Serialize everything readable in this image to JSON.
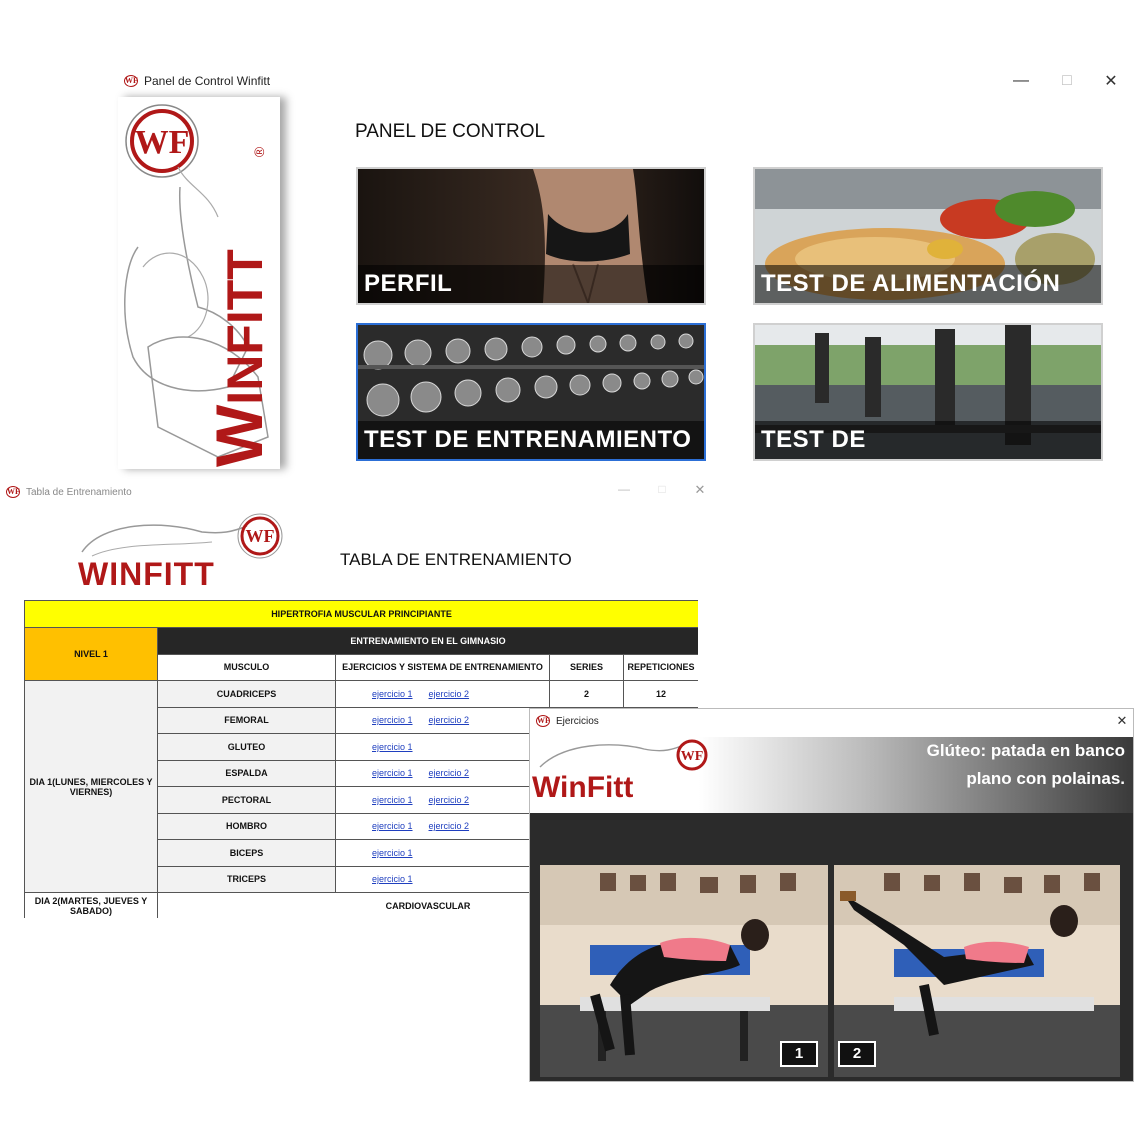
{
  "main_window": {
    "title": "Panel de Control Winfitt",
    "heading": "PANEL DE CONTROL",
    "tiles": [
      {
        "label": "PERFIL"
      },
      {
        "label": "TEST DE ALIMENTACIÓN"
      },
      {
        "label": "TEST DE ENTRENAMIENTO"
      },
      {
        "label": "TEST DE CARDIOVASCULAR"
      }
    ],
    "logo": {
      "letters": "WF",
      "word": "WINFITT"
    }
  },
  "training_window": {
    "title": "Tabla de Entrenamiento",
    "heading": "TABLA DE ENTRENAMIENTO",
    "logo_word": "WINFITT",
    "table": {
      "banner": "HIPERTROFIA MUSCULAR PRINCIPIANTE",
      "level": "NIVEL 1",
      "section": "ENTRENAMIENTO EN EL GIMNASIO",
      "headers": [
        "MUSCULO",
        "EJERCICIOS Y SISTEMA DE ENTRENAMIENTO",
        "SERIES",
        "REPETICIONES"
      ],
      "day1": "DIA 1(LUNES, MIERCOLES Y VIERNES)",
      "day2": "DIA 2(MARTES, JUEVES Y SABADO)",
      "day2_activity": "CARDIOVASCULAR",
      "link1": "ejercicio 1",
      "link2": "ejercicio 2",
      "rows": [
        {
          "muscle": "CUADRICEPS",
          "series": "2",
          "reps": "12"
        },
        {
          "muscle": "FEMORAL",
          "series": "",
          "reps": ""
        },
        {
          "muscle": "GLUTEO",
          "series": "",
          "reps": ""
        },
        {
          "muscle": "ESPALDA",
          "series": "",
          "reps": ""
        },
        {
          "muscle": "PECTORAL",
          "series": "",
          "reps": ""
        },
        {
          "muscle": "HOMBRO",
          "series": "",
          "reps": ""
        },
        {
          "muscle": "BICEPS",
          "series": "",
          "reps": ""
        },
        {
          "muscle": "TRICEPS",
          "series": "",
          "reps": ""
        }
      ]
    }
  },
  "exercise_window": {
    "title": "Ejercicios",
    "logo_word": "WinFitt",
    "caption_line1": "Glúteo:  patada en banco",
    "caption_line2": "plano con polainas.",
    "step1": "1",
    "step2": "2"
  },
  "colors": {
    "brand_red": "#b01818",
    "banner_yellow": "#ffff00",
    "level_orange": "#ffc000",
    "section_dark": "#262626"
  }
}
